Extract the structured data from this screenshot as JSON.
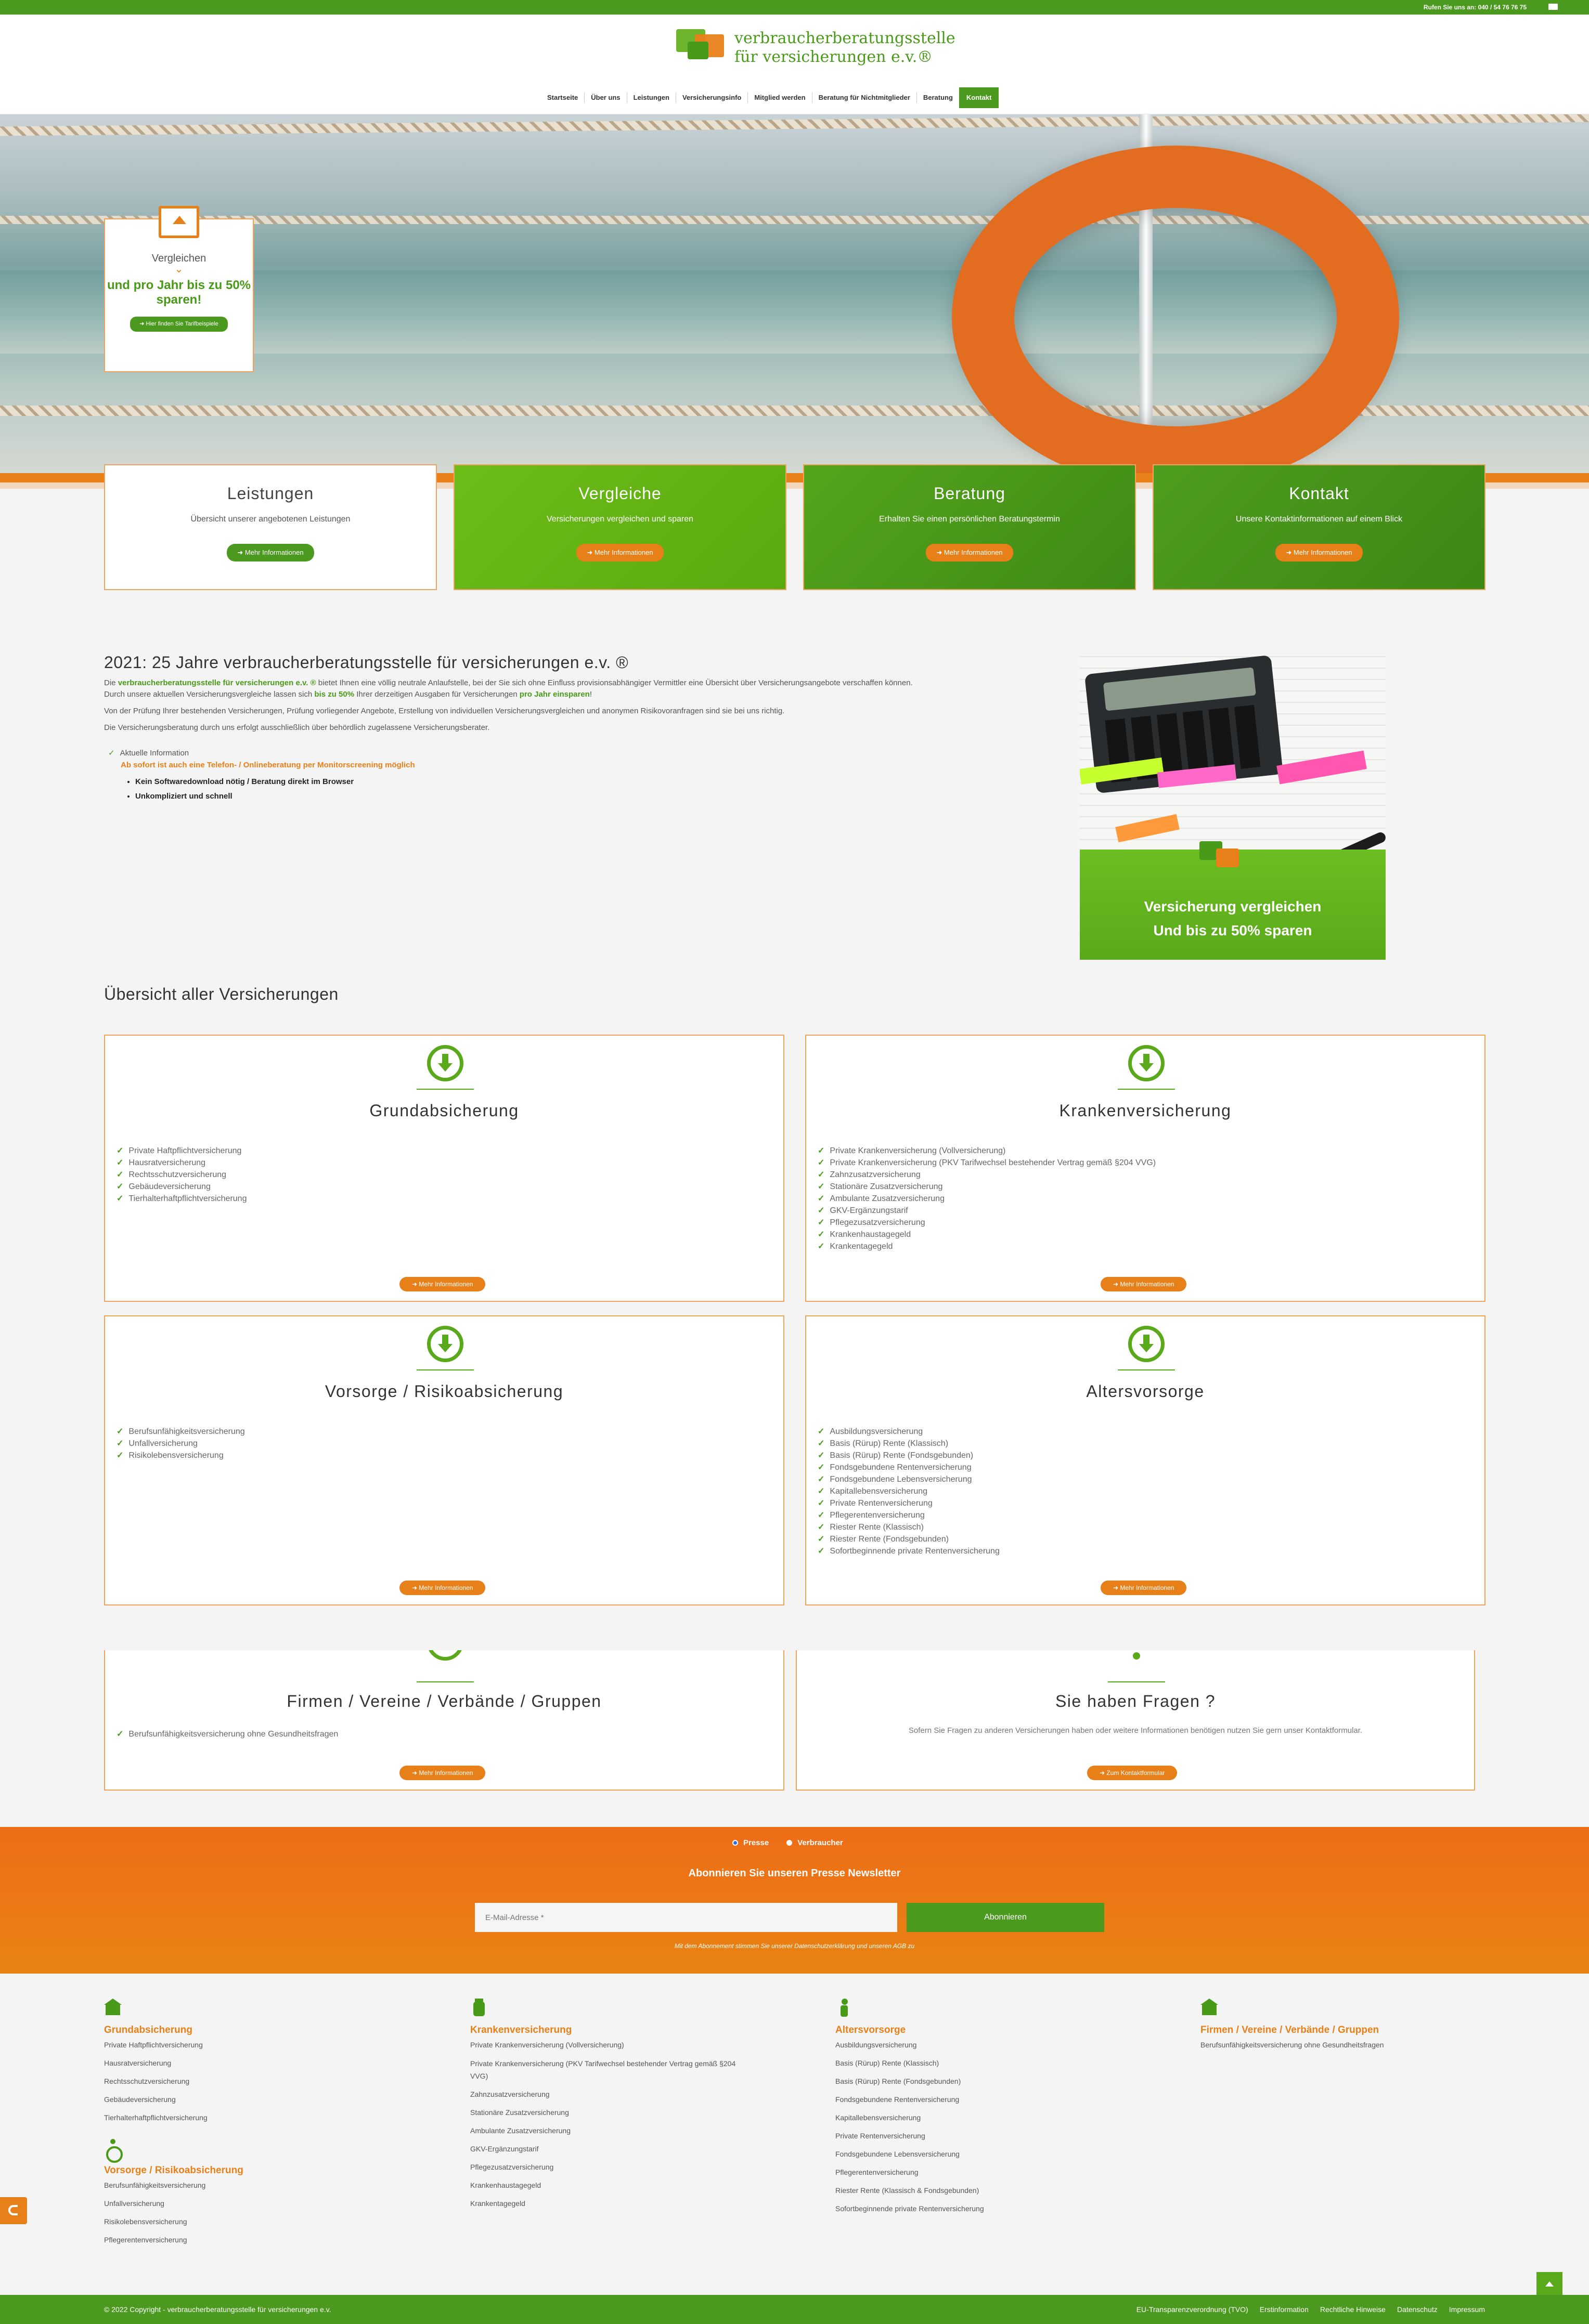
{
  "topbar": {
    "call": "Rufen Sie uns an: 040 / 54 76 76 75",
    "mail_icon": "mail-icon"
  },
  "logo": {
    "line1": "verbraucherberatungsstelle",
    "line2": "für versicherungen e.v.®"
  },
  "nav": [
    "Startseite",
    "Über uns",
    "Leistungen",
    "Versicherungsinfo",
    "Mitglied werden",
    "Beratung für Nichtmitglieder",
    "Beratung",
    "Kontakt"
  ],
  "promo": {
    "title": "Vergleichen",
    "save": "und pro Jahr bis zu 50% sparen!",
    "button": "➜ Hier finden Sie Tarifbeispiele",
    "icon": "upload-screen-icon"
  },
  "features": [
    {
      "title": "Leistungen",
      "sub": "Übersicht unserer angebotenen Leistungen",
      "button": "➜ Mehr Informationen"
    },
    {
      "title": "Vergleiche",
      "sub": "Versicherungen vergleichen und sparen",
      "button": "➜ Mehr Informationen"
    },
    {
      "title": "Beratung",
      "sub": "Erhalten Sie einen persönlichen Beratungstermin",
      "button": "➜ Mehr Informationen"
    },
    {
      "title": "Kontakt",
      "sub": "Unsere Kontaktinformationen auf einem Blick",
      "button": "➜ Mehr Informationen"
    }
  ],
  "about": {
    "heading": "2021: 25 Jahre verbraucherberatungsstelle für versicherungen e.v. ®",
    "p1_pre": "Die ",
    "p1_brand": "verbraucherberatungsstelle für versicherungen e.v. ®",
    "p1_post": " bietet Ihnen eine völlig neutrale Anlaufstelle, bei der Sie sich ohne Einfluss provisionsabhängiger Vermittler eine Übersicht über Versicherungsangebote verschaffen können.",
    "p2_pre": "Durch unsere aktuellen Versicherungsvergleiche lassen sich ",
    "p2_b1": "bis zu 50%",
    "p2_mid": " Ihrer derzeitigen Ausgaben für Versicherungen ",
    "p2_b2": "pro Jahr einsparen",
    "p2_post": "!",
    "p3": "Von der Prüfung Ihrer bestehenden Versicherungen, Prüfung vorliegender Angebote, Erstellung von individuellen Versicherungsvergleichen und anonymen Risikovoranfragen sind sie bei uns richtig.",
    "p4": "Die Versicherungsberatung durch uns erfolgt ausschließlich über behördlich zugelassene Versicherungsberater.",
    "info_label": "Aktuelle Information",
    "info_highlight": "Ab sofort ist auch eine Telefon- / Onlineberatung per Monitorscreening möglich",
    "bullets": [
      "Kein Softwaredownload nötig / Beratung direkt im Browser",
      "Unkompliziert und schnell"
    ]
  },
  "calc_banner": {
    "line1": "Versicherung vergleichen",
    "line2": "Und bis zu 50% sparen"
  },
  "overview": {
    "title": "Übersicht aller Versicherungen",
    "cards": [
      {
        "title": "Grundabsicherung",
        "items": [
          "Private Haftpflichtversicherung",
          "Hausratversicherung",
          "Rechtsschutzversicherung",
          "Gebäudeversicherung",
          "Tierhalterhaftpflichtversicherung"
        ],
        "button": "➜ Mehr Informationen"
      },
      {
        "title": "Krankenversicherung",
        "items": [
          "Private Krankenversicherung (Vollversicherung)",
          "Private Krankenversicherung (PKV Tarifwechsel bestehender Vertrag gemäß §204 VVG)",
          "Zahnzusatzversicherung",
          "Stationäre Zusatzversicherung",
          "Ambulante Zusatzversicherung",
          "GKV-Ergänzungstarif",
          "Pflegezusatzversicherung",
          "Krankenhaustagegeld",
          "Krankentagegeld"
        ],
        "button": "➜ Mehr Informationen"
      },
      {
        "title": "Vorsorge / Risikoabsicherung",
        "items": [
          "Berufsunfähigkeitsversicherung",
          "Unfallversicherung",
          "Risikolebensversicherung"
        ],
        "button": "➜ Mehr Informationen"
      },
      {
        "title": "Altersvorsorge",
        "items": [
          "Ausbildungsversicherung",
          "Basis (Rürup) Rente (Klassisch)",
          "Basis (Rürup) Rente (Fondsgebunden)",
          "Fondsgebundene Rentenversicherung",
          "Fondsgebundene Lebensversicherung",
          "Kapitallebensversicherung",
          "Private Rentenversicherung",
          "Pflegerentenversicherung",
          "Riester Rente (Klassisch)",
          "Riester Rente (Fondsgebunden)",
          "Sofortbeginnende private Rentenversicherung"
        ],
        "button": "➜ Mehr Informationen"
      },
      {
        "title": "Firmen / Vereine / Verbände / Gruppen",
        "items": [
          "Berufsunfähigkeitsversicherung ohne Gesundheitsfragen"
        ],
        "button": "➜ Mehr Informationen"
      },
      {
        "title": "Sie haben Fragen ?",
        "text": "Sofern Sie Fragen zu anderen Versicherungen haben oder weitere Informationen benötigen nutzen Sie gern unser Kontaktformular.",
        "button": "➜ Zum Kontaktformular"
      }
    ]
  },
  "newsletter": {
    "radio1": "Presse",
    "radio2": "Verbraucher",
    "title": "Abonnieren Sie unseren Presse Newsletter",
    "placeholder": "E-Mail-Adresse *",
    "button": "Abonnieren",
    "legal": "Mit dem Abonnement stimmen Sie unserer Datenschutzerklärung und unseren AGB zu"
  },
  "footer": {
    "cols": [
      {
        "heading": "Grundabsicherung",
        "icon": "house-icon",
        "links": [
          "Private Haftpflichtversicherung",
          "Hausratversicherung",
          "Rechtsschutzversicherung",
          "Gebäudeversicherung",
          "Tierhalterhaftpflichtversicherung"
        ]
      },
      {
        "heading": "Krankenversicherung",
        "icon": "medicine-jar-icon",
        "links": [
          "Private Krankenversicherung (Vollversicherung)",
          "Private Krankenversicherung (PKV Tarifwechsel bestehender Vertrag gemäß §204 VVG)",
          "Zahnzusatzversicherung",
          "Stationäre Zusatzversicherung",
          "Ambulante Zusatzversicherung",
          "GKV-Ergänzungstarif",
          "Pflegezusatzversicherung",
          "Krankenhaustagegeld",
          "Krankentagegeld"
        ]
      },
      {
        "heading": "Altersvorsorge",
        "icon": "elderly-person-icon",
        "links": [
          "Ausbildungsversicherung",
          "Basis (Rürup) Rente (Klassisch)",
          "Basis (Rürup) Rente (Fondsgebunden)",
          "Fondsgebundene Rentenversicherung",
          "Kapitallebensversicherung",
          "Private Rentenversicherung",
          "Fondsgebundene Lebensversicherung",
          "Pflegerentenversicherung",
          "Riester Rente (Klassisch & Fondsgebunden)",
          "Sofortbeginnende private Rentenversicherung"
        ]
      },
      {
        "heading": "Firmen / Vereine / Verbände / Gruppen",
        "icon": "building-icon",
        "links": [
          "Berufsunfähigkeitsversicherung ohne Gesundheitsfragen"
        ]
      },
      {
        "heading": "Vorsorge / Risikoabsicherung",
        "icon": "wheelchair-icon",
        "links": [
          "Berufsunfähigkeitsversicherung",
          "Unfallversicherung",
          "Risikolebensversicherung",
          "Pflegerentenversicherung"
        ]
      }
    ],
    "copyright": "© 2022 Copyright - verbraucherberatungsstelle für versicherungen e.v.",
    "legal_links": [
      "EU-Transparenzverordnung (TVO)",
      "Erstinformation",
      "Rechtliche Hinweise",
      "Datenschutz",
      "Impressum"
    ]
  }
}
